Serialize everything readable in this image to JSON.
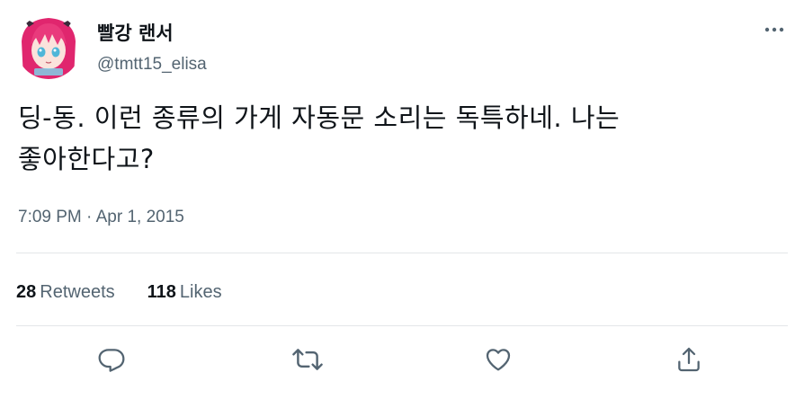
{
  "author": {
    "display_name": "빨강 랜서",
    "handle": "@tmtt15_elisa"
  },
  "tweet": {
    "line1": "딩-동. 이런 종류의 가게 자동문 소리는 독특하네. 나는",
    "line2": "좋아한다고?"
  },
  "meta": {
    "time": "7:09 PM",
    "separator": " · ",
    "date": "Apr 1, 2015"
  },
  "stats": {
    "retweets_count": "28",
    "retweets_label": "Retweets",
    "likes_count": "118",
    "likes_label": "Likes"
  },
  "icons": {
    "more": "more-horizontal-icon",
    "reply": "reply-icon",
    "retweet": "retweet-icon",
    "like": "heart-icon",
    "share": "share-icon"
  },
  "colors": {
    "text_primary": "#0f1419",
    "text_secondary": "#536471",
    "divider": "#e3e6e8",
    "avatar_hair": "#e0266e"
  }
}
